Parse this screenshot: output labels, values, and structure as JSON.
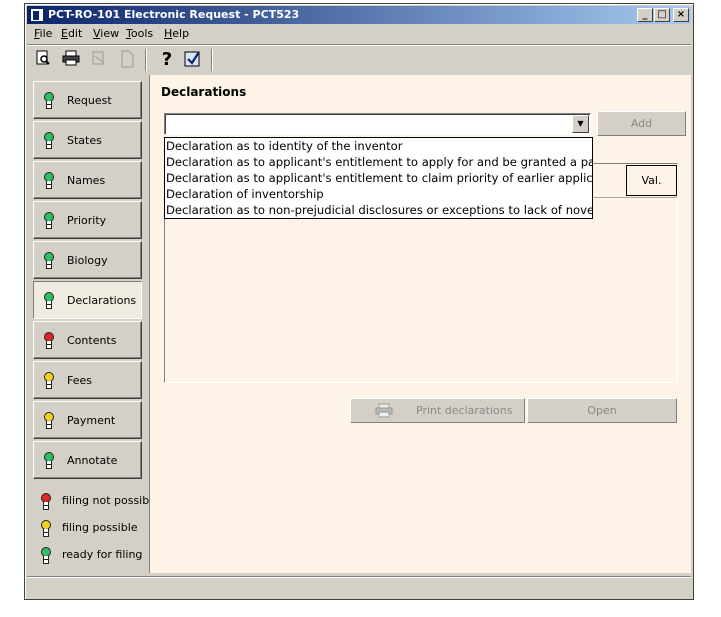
{
  "window": {
    "title": "PCT-RO-101 Electronic Request - PCT523",
    "controls": {
      "minimize": "_",
      "maximize": "□",
      "close": "×"
    }
  },
  "menu": [
    "File",
    "Edit",
    "View",
    "Tools",
    "Help"
  ],
  "toolbar": {
    "icons": [
      "preview-icon",
      "print-icon",
      "export-icon",
      "new-icon",
      "help-icon",
      "check-icon"
    ],
    "help_glyph": "?",
    "check_glyph": "✓",
    "print_glyph": "🖶"
  },
  "sidebar": {
    "items": [
      {
        "label": "Request",
        "status": "green"
      },
      {
        "label": "States",
        "status": "green"
      },
      {
        "label": "Names",
        "status": "green"
      },
      {
        "label": "Priority",
        "status": "green"
      },
      {
        "label": "Biology",
        "status": "green"
      },
      {
        "label": "Declarations",
        "status": "green",
        "active": true
      },
      {
        "label": "Contents",
        "status": "red"
      },
      {
        "label": "Fees",
        "status": "yellow"
      },
      {
        "label": "Payment",
        "status": "yellow"
      },
      {
        "label": "Annotate",
        "status": "green"
      }
    ],
    "legend": [
      {
        "label": "filing not possible",
        "status": "red"
      },
      {
        "label": "filing possible",
        "status": "yellow"
      },
      {
        "label": "ready for filing",
        "status": "green"
      }
    ]
  },
  "colors": {
    "red": "#d82828",
    "yellow": "#f0d020",
    "green": "#2ec060"
  },
  "main": {
    "heading": "Declarations",
    "combo_value": "",
    "combo_arrow": "▼",
    "add_label": "Add",
    "dropdown_items": [
      "Declaration as to identity of the inventor",
      "Declaration as to applicant's entitlement to apply for and be granted a pate",
      "Declaration as to applicant's entitlement to claim priority of earlier applicat",
      "Declaration of inventorship",
      "Declaration as to non-prejudicial disclosures or exceptions to lack of novelt"
    ],
    "column_val": "Val.",
    "print_label": "Print declarations",
    "open_label": "Open"
  }
}
